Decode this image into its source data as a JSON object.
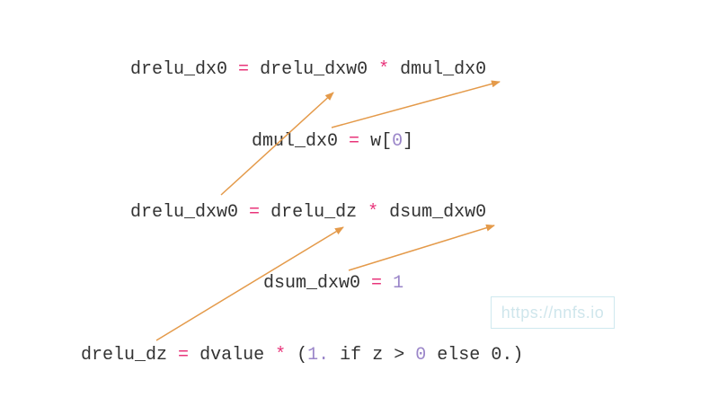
{
  "colors": {
    "text": "#333333",
    "operator": "#e8347a",
    "number": "#9b86c9",
    "arrow": "#e49a4a",
    "watermark": "#cfe6ec"
  },
  "equations": {
    "eq1": {
      "lhs": "drelu_dx0",
      "eq": "=",
      "a": "drelu_dxw0",
      "mul": "*",
      "b": "dmul_dx0"
    },
    "eq2": {
      "lhs": "dmul_dx0",
      "eq": "=",
      "w": "w",
      "lb": "[",
      "idx": "0",
      "rb": "]"
    },
    "eq3": {
      "lhs": "drelu_dxw0",
      "eq": "=",
      "a": "drelu_dz",
      "mul": "*",
      "b": "dsum_dxw0"
    },
    "eq4": {
      "lhs": "dsum_dxw0",
      "eq": "=",
      "val": "1"
    },
    "eq5": {
      "lhs": "drelu_dz",
      "eq": "=",
      "a": "dvalue",
      "mul": "*",
      "lp": "(",
      "one": "1.",
      "if_kw": "if",
      "z": "z",
      "gt": ">",
      "zero": "0",
      "else_kw": "else",
      "tail": "0.)"
    }
  },
  "watermark": "https://nnfs.io"
}
